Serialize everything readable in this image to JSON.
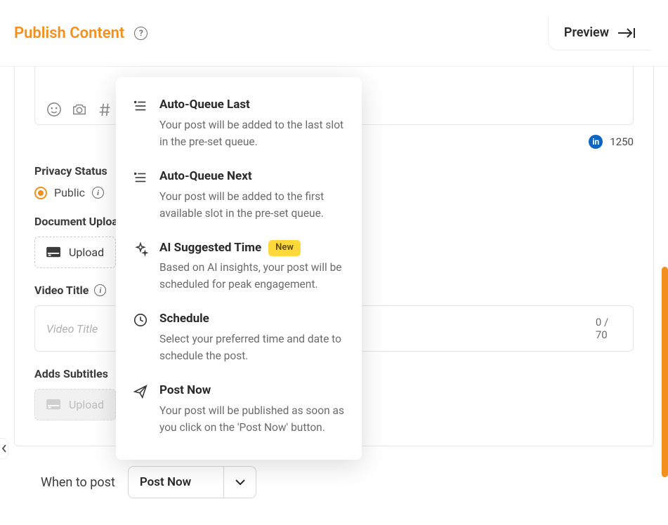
{
  "header": {
    "title": "Publish Content",
    "preview": "Preview"
  },
  "compose": {
    "char_count": "1250"
  },
  "privacy": {
    "label": "Privacy Status",
    "option_public": "Public"
  },
  "doc_upload": {
    "label": "Document Upload",
    "button": "Upload"
  },
  "video": {
    "label": "Video Title",
    "placeholder": "Video Title",
    "counter": "0 / 70"
  },
  "subtitles": {
    "label": "Adds Subtitles",
    "button": "Upload"
  },
  "when": {
    "label": "When to post",
    "value": "Post Now"
  },
  "menu": {
    "items": [
      {
        "title": "Auto-Queue Last",
        "desc": "Your post will be added to the last slot in the pre-set queue."
      },
      {
        "title": "Auto-Queue Next",
        "desc": "Your post will be added to the first available slot in the pre-set queue."
      },
      {
        "title": "AI Suggested Time",
        "badge": "New",
        "desc": "Based on AI insights, your post will be scheduled for peak engagement."
      },
      {
        "title": "Schedule",
        "desc": "Select your preferred time and date to schedule the post."
      },
      {
        "title": "Post Now",
        "desc": "Your post will be published as soon as you click on the 'Post Now' button."
      }
    ]
  }
}
